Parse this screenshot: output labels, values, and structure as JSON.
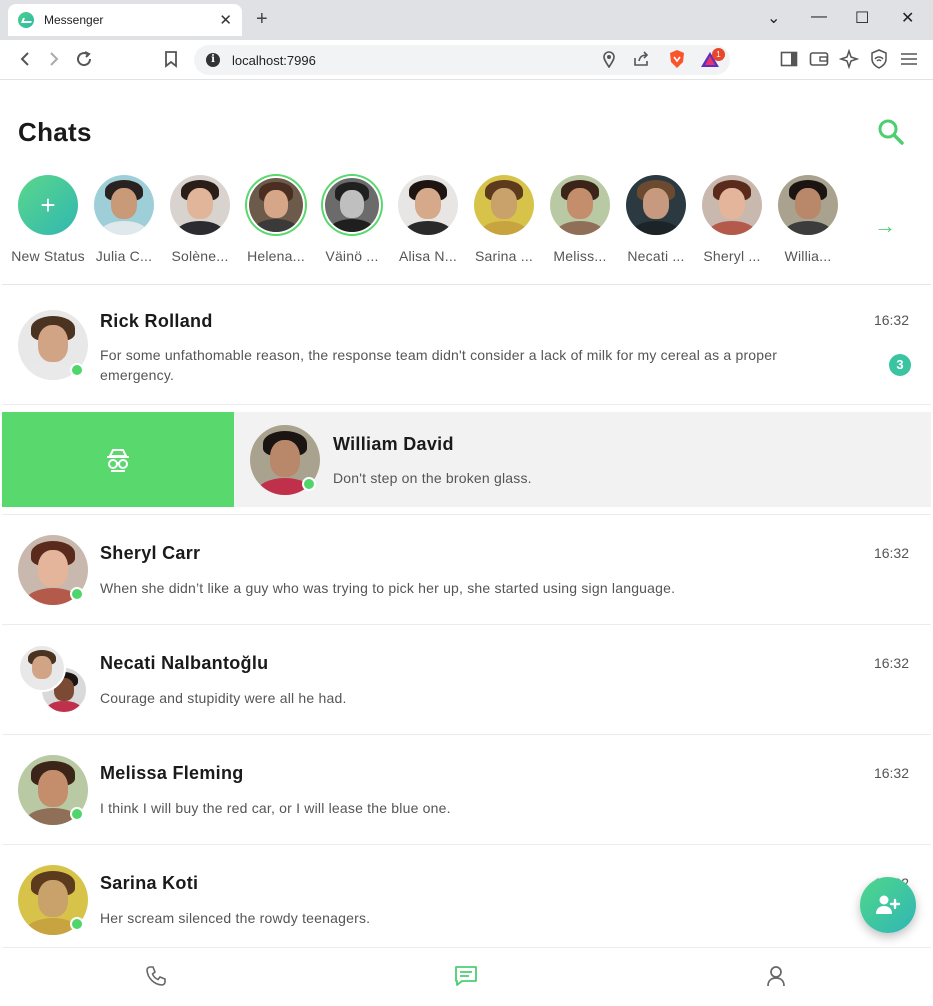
{
  "browser": {
    "tab_title": "Messenger",
    "tab_close": "✕",
    "new_tab": "+",
    "url": "localhost:7996",
    "brave_badge": "1",
    "window_controls": {
      "dropdown": "⌄",
      "minimize": "—",
      "maximize": "☐",
      "close": "✕"
    }
  },
  "app": {
    "title": "Chats",
    "accent_color": "#58d86d",
    "stories": [
      {
        "name": "New Status",
        "type": "new",
        "plus": "+"
      },
      {
        "name": "Julia C...",
        "ring": false,
        "skin": "#c89a78",
        "hair": "#2a2220",
        "bg": "#9ecfd8",
        "shirt": "#dfe8ea"
      },
      {
        "name": "Solène...",
        "ring": false,
        "skin": "#e0b59a",
        "hair": "#2b1d18",
        "bg": "#d9d3cf",
        "shirt": "#2c2c30"
      },
      {
        "name": "Helena...",
        "ring": true,
        "skin": "#d6a688",
        "hair": "#4a2e22",
        "bg": "#6c5a4a",
        "shirt": "#3a3a3a"
      },
      {
        "name": "Väinö ...",
        "ring": true,
        "skin": "#bfbfbf",
        "hair": "#202020",
        "bg": "#6b6b6b",
        "shirt": "#1f1f1f"
      },
      {
        "name": "Alisa N...",
        "ring": false,
        "skin": "#d7a98b",
        "hair": "#1e1512",
        "bg": "#e8e6e4",
        "shirt": "#2a2a2a"
      },
      {
        "name": "Sarina ...",
        "ring": false,
        "skin": "#c9a16a",
        "hair": "#5b3a1e",
        "bg": "#d8c34a",
        "shirt": "#c8a440"
      },
      {
        "name": "Meliss...",
        "ring": false,
        "skin": "#c48e6c",
        "hair": "#3b2418",
        "bg": "#b9c9a3",
        "shirt": "#8f6f58"
      },
      {
        "name": "Necati ...",
        "ring": false,
        "skin": "#c79a80",
        "hair": "#6b4a2f",
        "bg": "#2b3a40",
        "shirt": "#1d2428"
      },
      {
        "name": "Sheryl ...",
        "ring": false,
        "skin": "#e4b59a",
        "hair": "#5a2b1c",
        "bg": "#c9b8ad",
        "shirt": "#b35a4a"
      },
      {
        "name": "Willia...",
        "ring": false,
        "skin": "#b9876a",
        "hair": "#1a1412",
        "bg": "#a9a28f",
        "shirt": "#3c3c3c"
      }
    ],
    "stories_next_icon": "→",
    "chats": [
      {
        "name": "Rick Rolland",
        "message": "For some unfathomable reason, the response team didn't consider a lack of milk for my cereal as a proper emergency.",
        "time": "16:32",
        "unread": "3",
        "online": true,
        "skin": "#d2a486",
        "hair": "#4b3322",
        "bg": "#e8e8e8",
        "shirt": "#e9e9e9"
      },
      {
        "name": "William David",
        "message": "Don't step on the broken glass.",
        "time": "",
        "online": true,
        "skin": "#b9876a",
        "hair": "#1a1412",
        "bg": "#a9a28f",
        "shirt": "#c0304a"
      },
      {
        "name": "Sheryl Carr",
        "message": "When she didn’t like a guy who was trying to pick her up, she started using sign language.",
        "time": "16:32",
        "online": true,
        "skin": "#e4b59a",
        "hair": "#5a2b1c",
        "bg": "#c9b8ad",
        "shirt": "#b35a4a"
      },
      {
        "name": "Necati Nalbantoğlu",
        "message": "Courage and stupidity were all he had.",
        "time": "16:32",
        "group": true
      },
      {
        "name": "Melissa Fleming",
        "message": "I think I will buy the red car, or I will lease the blue one.",
        "time": "16:32",
        "online": true,
        "skin": "#c48e6c",
        "hair": "#3b2418",
        "bg": "#b9c9a3",
        "shirt": "#8f6f58"
      },
      {
        "name": "Sarina Koti",
        "message": "Her scream silenced the rowdy teenagers.",
        "time": "16:32",
        "online": true,
        "skin": "#c9a16a",
        "hair": "#5b3a1e",
        "bg": "#d8c34a",
        "shirt": "#c8a440"
      }
    ],
    "group_avatars": [
      {
        "skin": "#d2a486",
        "hair": "#4b3322",
        "bg": "#e8e8e8",
        "shirt": "#e9e9e9"
      },
      {
        "skin": "#7a4a34",
        "hair": "#1a1412",
        "bg": "#d9d9d9",
        "shirt": "#c0304a"
      }
    ]
  }
}
